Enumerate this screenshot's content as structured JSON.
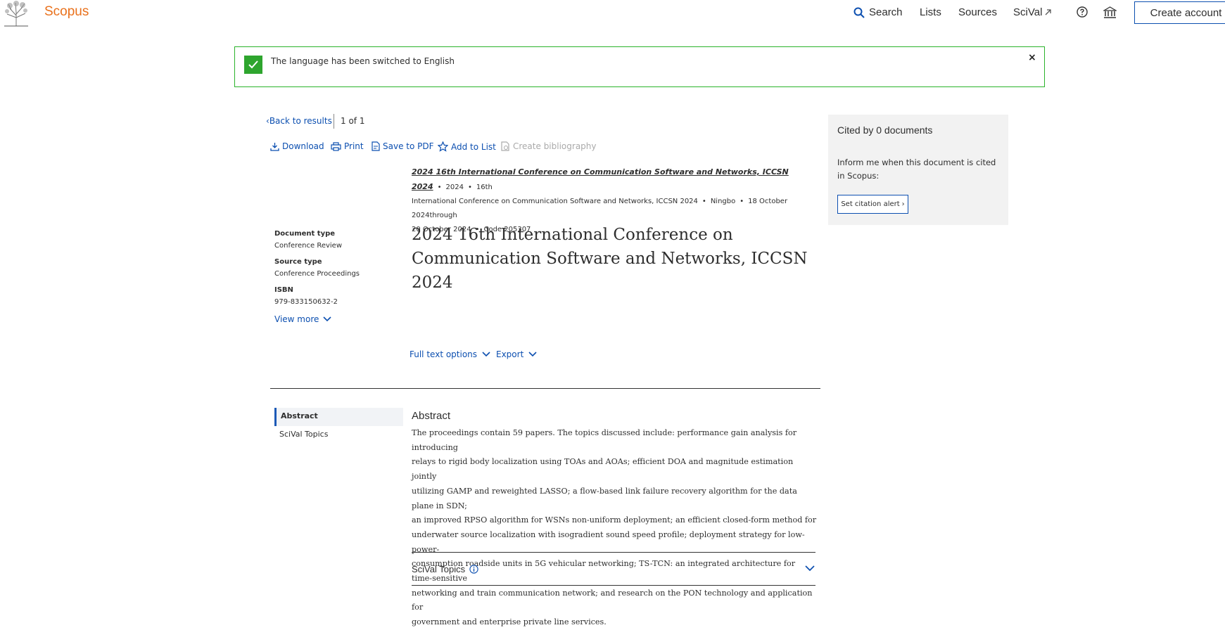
{
  "header": {
    "brand": "Scopus",
    "nav": {
      "search": "Search",
      "lists": "Lists",
      "sources": "Sources",
      "scival": "SciVal"
    },
    "create_account": "Create account",
    "icons": [
      "elsevier-tree-logo",
      "search-icon",
      "external-link-icon",
      "help-icon",
      "institution-icon"
    ]
  },
  "banner": {
    "message": "The language has been switched to English",
    "close": "×",
    "accent": "#2ea52e"
  },
  "results_nav": {
    "back": "Back to results",
    "pager": "1  of  1"
  },
  "actions": {
    "download": "Download",
    "print": "Print",
    "save_pdf": "Save to PDF",
    "add_list": "Add to List",
    "bibliography": "Create bibliography"
  },
  "source": {
    "name": "2024 16th International Conference on Communication Software and Networks, ICCSN 2024",
    "year": "2024",
    "conference_line1": "16th",
    "conference_line2": "International Conference on Communication Software and Networks, ICCSN 2024",
    "location": "Ningbo",
    "dates_line1": "18 October 2024through",
    "dates_line2": "20 October 2024",
    "code": "Code 205307"
  },
  "document": {
    "title": "2024 16th International Conference on Communication Software and Networks, ICCSN 2024"
  },
  "details": {
    "doc_type_label": "Document type",
    "doc_type": "Conference Review",
    "source_type_label": "Source type",
    "source_type": "Conference Proceedings",
    "isbn_label": "ISBN",
    "isbn": "979-833150632-2",
    "view_more": "View more"
  },
  "options": {
    "full_text": "Full text options",
    "export": "Export"
  },
  "sections": {
    "abstract_tab": "Abstract",
    "scival_tab": "SciVal Topics"
  },
  "abstract": {
    "heading": "Abstract",
    "lines": [
      "The proceedings contain 59 papers. The topics discussed include: performance gain analysis for introducing",
      "relays to rigid body localization using TOAs and AOAs; efficient DOA and magnitude estimation jointly",
      "utilizing GAMP and reweighted LASSO; a flow-based link failure recovery algorithm for the data plane in SDN;",
      "an improved RPSO algorithm for WSNs non-uniform deployment; an efficient closed-form method for",
      "underwater source localization with isogradient sound speed profile; deployment strategy for low-power-",
      "consumption roadside units in 5G vehicular networking; TS-TCN: an integrated architecture for time-sensitive",
      "networking and train communication network; and research on the PON technology and application for",
      "government and enterprise private line services."
    ]
  },
  "scival_topics": {
    "label": "SciVal Topics"
  },
  "cited": {
    "heading": "Cited by 0 documents",
    "text": "Inform me when this document is cited in Scopus:",
    "button": "Set citation alert"
  }
}
